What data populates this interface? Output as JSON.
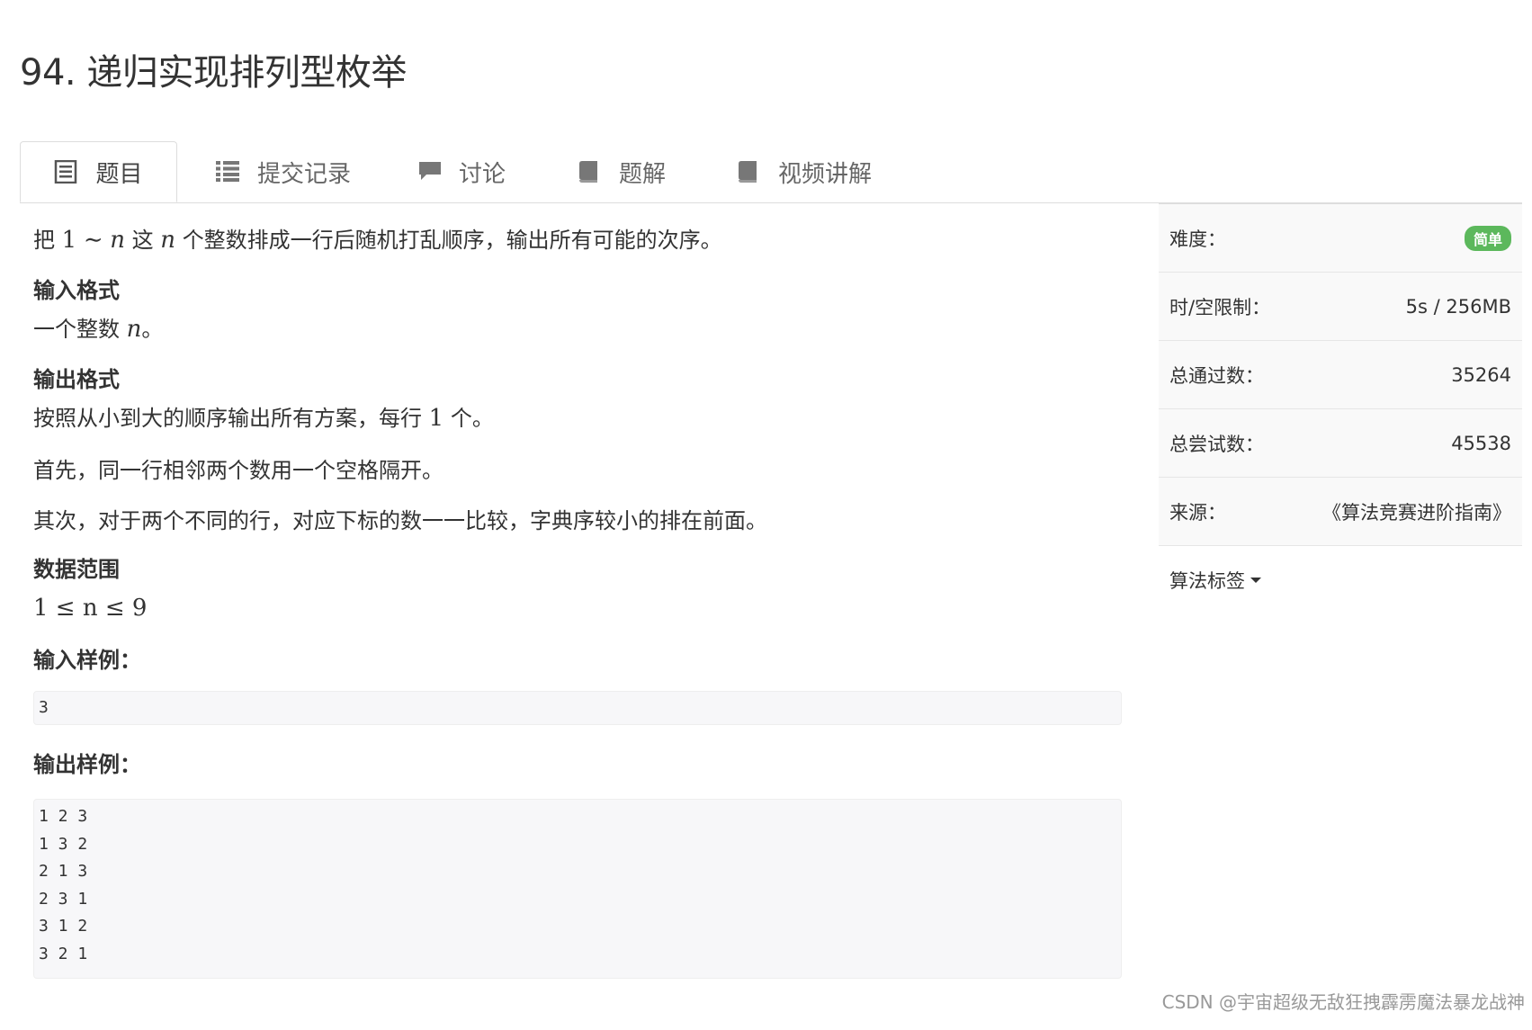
{
  "title": "94. 递归实现排列型枚举",
  "tabs": [
    {
      "label": "题目",
      "icon": "document-icon"
    },
    {
      "label": "提交记录",
      "icon": "list-icon"
    },
    {
      "label": "讨论",
      "icon": "comment-icon"
    },
    {
      "label": "题解",
      "icon": "book-icon"
    },
    {
      "label": "视频讲解",
      "icon": "book-icon"
    }
  ],
  "problem": {
    "desc_a": "把",
    "desc_math1": "1",
    "desc_tilde": "∼",
    "desc_n1": "n",
    "desc_b": "这",
    "desc_n2": "n",
    "desc_c": "个整数排成一行后随机打乱顺序，输出所有可能的次序。",
    "input_heading": "输入格式",
    "input_a": "一个整数",
    "input_n": "n",
    "input_b": "。",
    "output_heading": "输出格式",
    "output_a": "按照从小到大的顺序输出所有方案，每行",
    "output_num": "1",
    "output_b": "个。",
    "rule1": "首先，同一行相邻两个数用一个空格隔开。",
    "rule2": "其次，对于两个不同的行，对应下标的数一一比较，字典序较小的排在前面。",
    "range_heading": "数据范围",
    "range_expr": "1 ≤ n ≤ 9",
    "sample_in_heading": "输入样例：",
    "sample_in": [
      "3"
    ],
    "sample_out_heading": "输出样例：",
    "sample_out": [
      "1 2 3",
      "1 3 2",
      "2 1 3",
      "2 3 1",
      "3 1 2",
      "3 2 1"
    ]
  },
  "sidebar": {
    "difficulty_label": "难度：",
    "difficulty_value": "简单",
    "limit_label": "时/空限制：",
    "limit_value": "5s / 256MB",
    "passed_label": "总通过数：",
    "passed_value": "35264",
    "tried_label": "总尝试数：",
    "tried_value": "45538",
    "source_label": "来源：",
    "source_value": "《算法竞赛进阶指南》",
    "tags_label": "算法标签"
  },
  "watermark": "CSDN @宇宙超级无敌狂拽霹雳魔法暴龙战神",
  "colors": {
    "badge": "#5cb85c",
    "code_bg": "#f7f7f9",
    "sidebar_bg": "#f9f9f9"
  }
}
